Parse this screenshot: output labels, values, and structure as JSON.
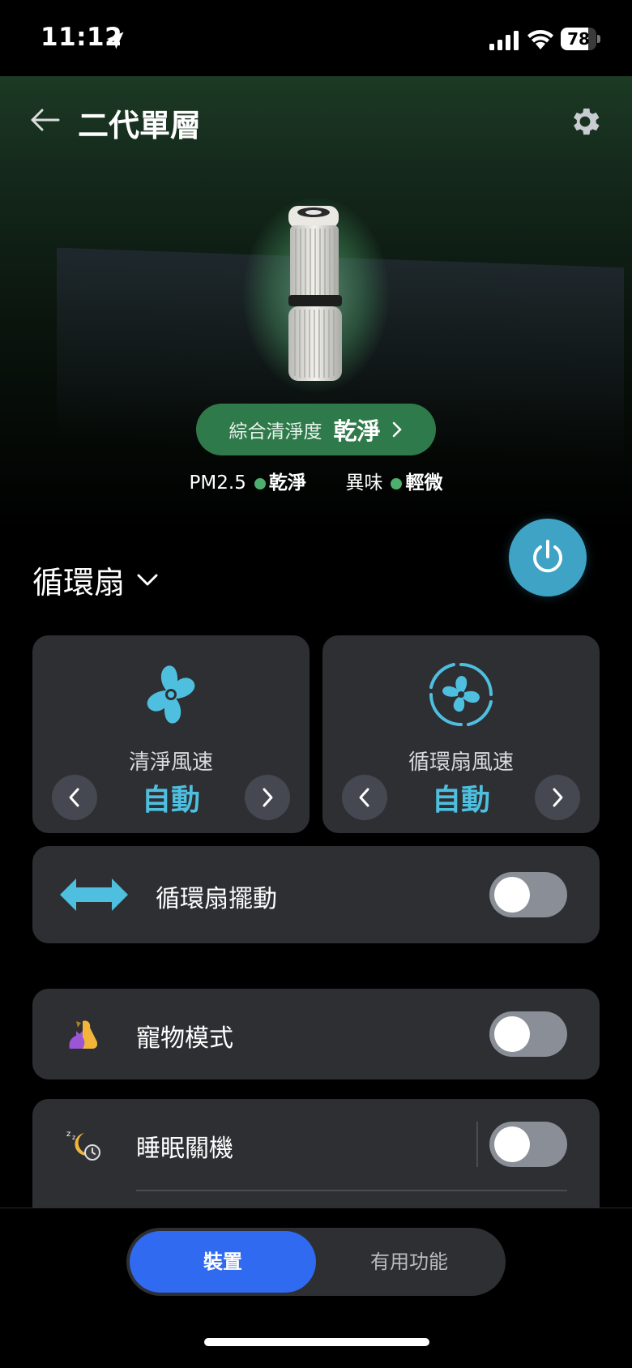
{
  "status_bar": {
    "time": "11:12",
    "battery": "78",
    "battery_level": 0.78,
    "icons": [
      "location-arrow-icon",
      "signal-icon",
      "wifi-icon",
      "battery-icon"
    ]
  },
  "header": {
    "title": "二代單層",
    "back_icon": "back-arrow-icon",
    "settings_icon": "gear-icon"
  },
  "air_quality": {
    "overall_label": "綜合清淨度",
    "overall_value": "乾淨",
    "pm25_label": "PM2.5",
    "pm25_value": "乾淨",
    "odor_label": "異味",
    "odor_value": "輕微",
    "status_color": "#4caf6e"
  },
  "mode": {
    "selected": "循環扇",
    "power_icon": "power-icon",
    "accent_color": "#3ea3c4"
  },
  "speed_cards": [
    {
      "label": "清淨風速",
      "value": "自動",
      "icon": "fan-icon"
    },
    {
      "label": "循環扇風速",
      "value": "自動",
      "icon": "circulator-fan-icon"
    }
  ],
  "swing": {
    "label": "循環扇擺動",
    "icon": "swing-arrows-icon",
    "on": false
  },
  "pet_mode": {
    "label": "寵物模式",
    "icon": "pet-icon",
    "on": false
  },
  "sleep_off": {
    "label": "睡眠關機",
    "icon": "sleep-timer-icon",
    "on": false
  },
  "bottom_tabs": {
    "active": "裝置",
    "inactive": "有用功能",
    "active_color": "#2f6af0"
  }
}
